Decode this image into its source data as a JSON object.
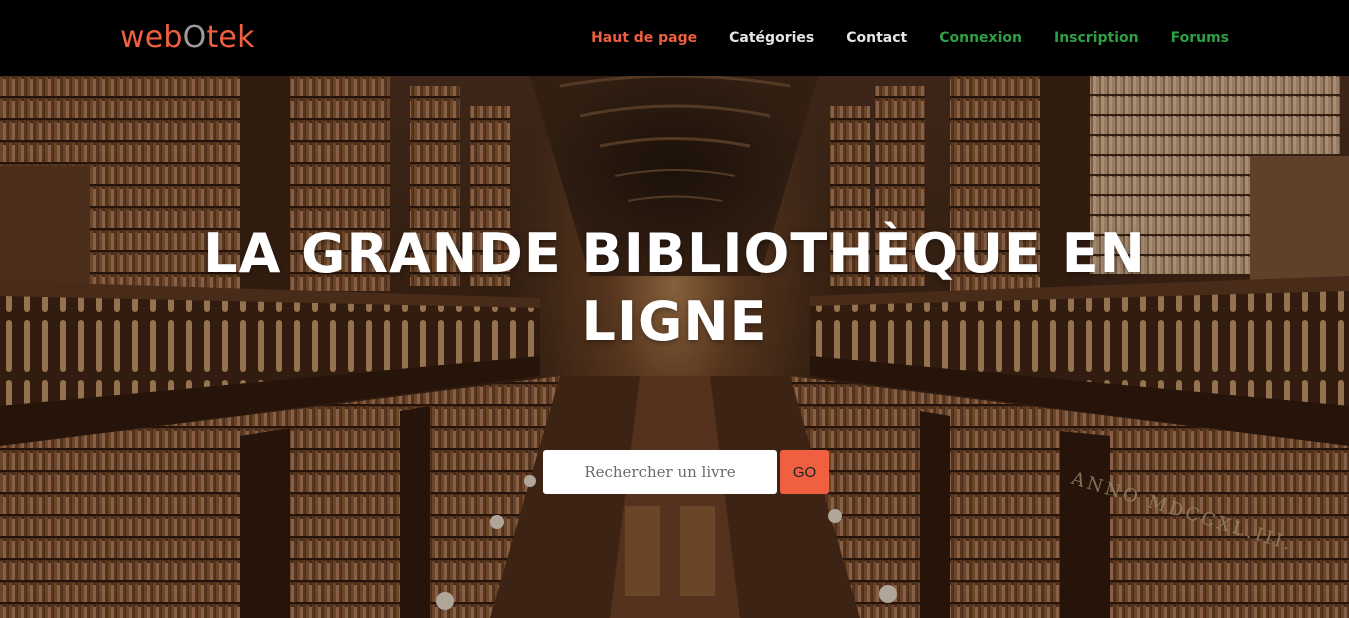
{
  "brand": {
    "prefix": "web",
    "o": "O",
    "suffix": "tek"
  },
  "nav": {
    "items": [
      {
        "label": "Haut de page",
        "color": "#f05f40"
      },
      {
        "label": "Catégories",
        "color": "#e6e6e6"
      },
      {
        "label": "Contact",
        "color": "#e6e6e6"
      },
      {
        "label": "Connexion",
        "color": "#2ea043"
      },
      {
        "label": "Inscription",
        "color": "#2ea043"
      },
      {
        "label": "Forums",
        "color": "#2ea043"
      }
    ]
  },
  "hero": {
    "title_line1": "LA GRANDE BIBLIOTHÈQUE EN",
    "title_line2": "LIGNE",
    "search_placeholder": "Rechercher un livre",
    "go_label": "GO",
    "inscription": "ANNO MDCCXL.III."
  },
  "colors": {
    "accent": "#f05f40",
    "nav_green": "#2ea043",
    "nav_bg": "#000000"
  }
}
